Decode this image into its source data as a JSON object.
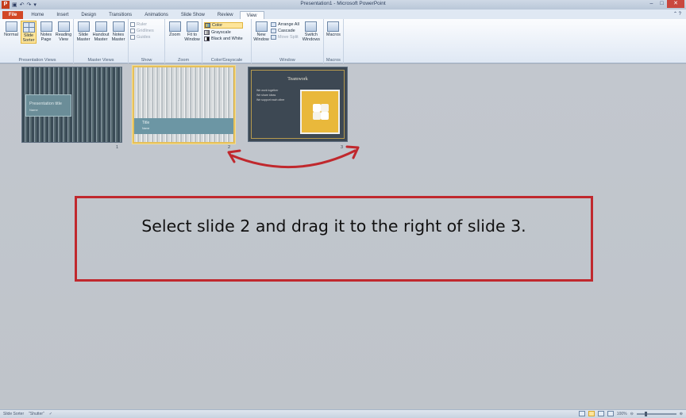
{
  "window": {
    "title": "Presentation1 - Microsoft PowerPoint"
  },
  "qat": {
    "save_icon": "save-icon",
    "undo_icon": "undo-icon",
    "redo_icon": "redo-icon"
  },
  "tabs": [
    {
      "label": "File"
    },
    {
      "label": "Home"
    },
    {
      "label": "Insert"
    },
    {
      "label": "Design"
    },
    {
      "label": "Transitions"
    },
    {
      "label": "Animations"
    },
    {
      "label": "Slide Show"
    },
    {
      "label": "Review"
    },
    {
      "label": "View"
    }
  ],
  "ribbon": {
    "presentation_views": {
      "label": "Presentation Views",
      "normal": "Normal",
      "slide_sorter": "Slide Sorter",
      "notes_page": "Notes Page",
      "reading_view": "Reading View"
    },
    "master_views": {
      "label": "Master Views",
      "slide_master": "Slide Master",
      "handout_master": "Handout Master",
      "notes_master": "Notes Master"
    },
    "show": {
      "label": "Show",
      "ruler": "Ruler",
      "gridlines": "Gridlines",
      "guides": "Guides"
    },
    "zoom": {
      "label": "Zoom",
      "zoom": "Zoom",
      "fit_to_window": "Fit to Window"
    },
    "color_grayscale": {
      "label": "Color/Grayscale",
      "color": "Color",
      "grayscale": "Grayscale",
      "black_and_white": "Black and White"
    },
    "window": {
      "label": "Window",
      "new_window": "New Window",
      "arrange_all": "Arrange All",
      "cascade": "Cascade",
      "move_split": "Move Split",
      "switch_windows": "Switch Windows"
    },
    "macros": {
      "label": "Macros",
      "macros": "Macros"
    }
  },
  "slides": [
    {
      "number": "1",
      "title": "Presentation title",
      "subtitle": "Name"
    },
    {
      "number": "2",
      "title": "Title",
      "subtitle": "Name"
    },
    {
      "number": "3",
      "title": "Teamwork",
      "bullets": [
        "We work together",
        "We share ideas",
        "We support each other"
      ]
    }
  ],
  "callout": {
    "text": "Select slide 2 and drag it to the right of slide 3."
  },
  "statusbar": {
    "view": "Slide Sorter",
    "theme": "\"Shutter\"",
    "zoom": "100%"
  },
  "colors": {
    "accent_red": "#c0282d",
    "selection_gold": "#e6c05a",
    "file_tab": "#d24726"
  }
}
